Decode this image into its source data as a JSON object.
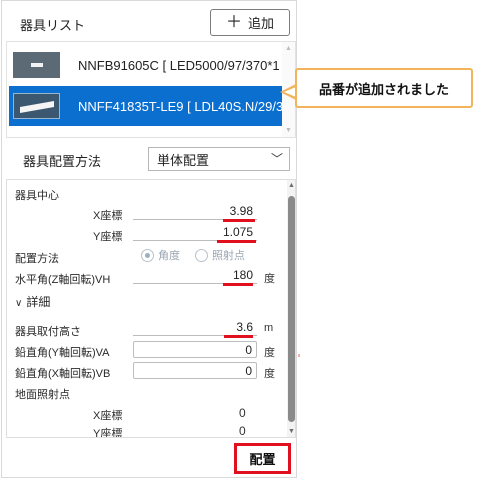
{
  "panel": {
    "title": "器具リスト",
    "add_label": "追加"
  },
  "fixtures": [
    {
      "label": "NNFB91605C [ LED5000/97/370*1",
      "selected": false
    },
    {
      "label": "NNFF41835T-LE9 [ LDL40S.N/29/3",
      "selected": true
    }
  ],
  "placement": {
    "label": "器具配置方法",
    "selected": "単体配置"
  },
  "properties": {
    "center_section": "器具中心",
    "x_label": "X座標",
    "x_value": "3.98",
    "y_label": "Y座標",
    "y_value": "1.075",
    "method_label": "配置方法",
    "radio_angle": "角度",
    "radio_point": "照射点",
    "vh_label": "水平角(Z軸回転)VH",
    "vh_value": "180",
    "vh_unit": "度",
    "detail_label": "詳細",
    "height_label": "器具取付高さ",
    "height_value": "3.6",
    "height_unit": "m",
    "va_label": "鉛直角(Y軸回転)VA",
    "va_value": "0",
    "va_unit": "度",
    "vb_label": "鉛直角(X軸回転)VB",
    "vb_value": "0",
    "vb_unit": "度",
    "ground_section": "地面照射点",
    "gx_label": "X座標",
    "gx_value": "0",
    "gy_label": "Y座標",
    "gy_value": "0"
  },
  "place_button": "配置",
  "callout": "品番が追加されました",
  "colors": {
    "selection": "#0b6fd0",
    "highlight": "#e0101f",
    "callout_border": "#f2b35b"
  }
}
